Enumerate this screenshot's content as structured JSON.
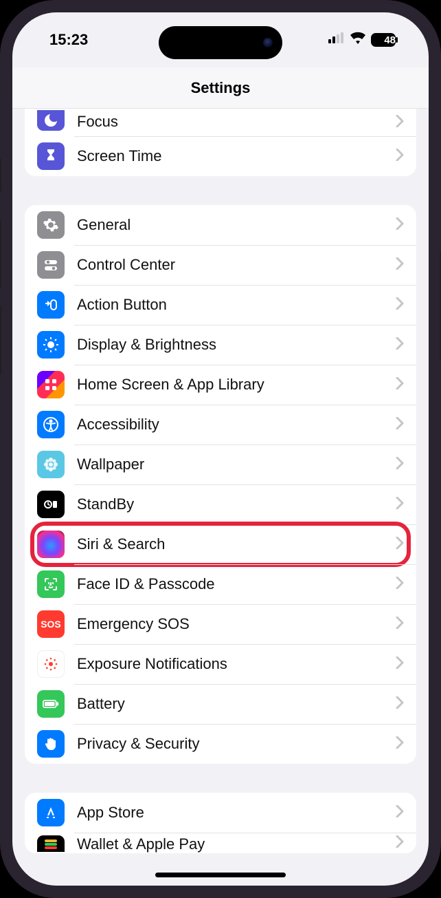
{
  "status": {
    "time": "15:23",
    "battery_pct": "48"
  },
  "header": {
    "title": "Settings"
  },
  "group1": [
    {
      "key": "focus",
      "label": "Focus",
      "icon": "moon",
      "bg": "bg-purple"
    },
    {
      "key": "screentime",
      "label": "Screen Time",
      "icon": "hourglass",
      "bg": "bg-purple"
    }
  ],
  "group2": [
    {
      "key": "general",
      "label": "General",
      "icon": "gear",
      "bg": "bg-grey"
    },
    {
      "key": "control",
      "label": "Control Center",
      "icon": "toggles",
      "bg": "bg-grey"
    },
    {
      "key": "action",
      "label": "Action Button",
      "icon": "action",
      "bg": "bg-blue"
    },
    {
      "key": "display",
      "label": "Display & Brightness",
      "icon": "sun",
      "bg": "bg-blue"
    },
    {
      "key": "homescreen",
      "label": "Home Screen & App Library",
      "icon": "grid",
      "bg": "bg-home"
    },
    {
      "key": "accessibility",
      "label": "Accessibility",
      "icon": "person",
      "bg": "bg-blue"
    },
    {
      "key": "wallpaper",
      "label": "Wallpaper",
      "icon": "flower",
      "bg": "bg-teal"
    },
    {
      "key": "standby",
      "label": "StandBy",
      "icon": "clockcard",
      "bg": "bg-black"
    },
    {
      "key": "siri",
      "label": "Siri & Search",
      "icon": "siri",
      "bg": "bg-siri",
      "highlight": true
    },
    {
      "key": "faceid",
      "label": "Face ID & Passcode",
      "icon": "face",
      "bg": "bg-green"
    },
    {
      "key": "sos",
      "label": "Emergency SOS",
      "icon": "sos",
      "bg": "bg-red"
    },
    {
      "key": "exposure",
      "label": "Exposure Notifications",
      "icon": "exposure",
      "bg": "bg-white"
    },
    {
      "key": "battery",
      "label": "Battery",
      "icon": "battery",
      "bg": "bg-green"
    },
    {
      "key": "privacy",
      "label": "Privacy & Security",
      "icon": "hand",
      "bg": "bg-blue"
    }
  ],
  "group3": [
    {
      "key": "appstore",
      "label": "App Store",
      "icon": "appstore",
      "bg": "bg-blue"
    },
    {
      "key": "wallet",
      "label": "Wallet & Apple Pay",
      "icon": "wallet",
      "bg": "bg-wallet"
    }
  ]
}
